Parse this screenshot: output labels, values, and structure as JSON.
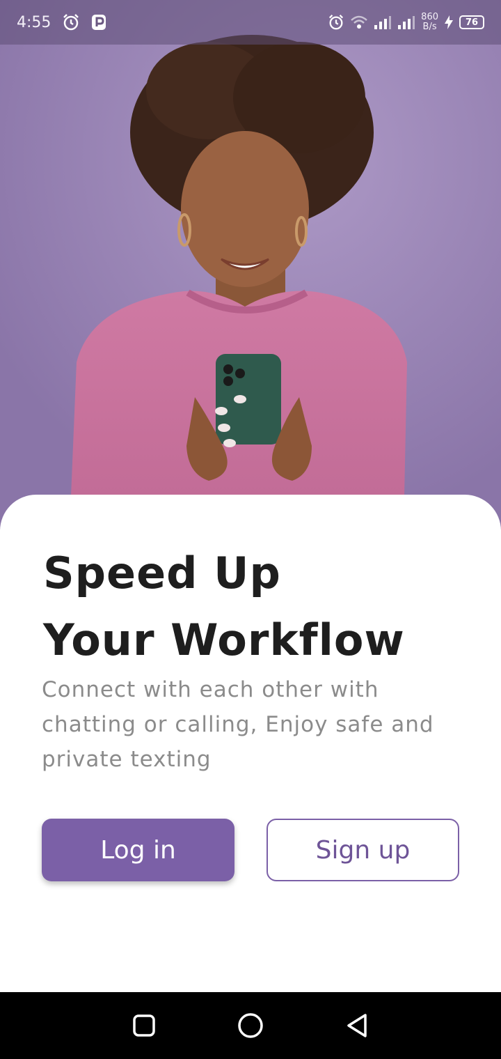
{
  "status_bar": {
    "time": "4:55",
    "net_speed_value": "860",
    "net_speed_unit": "B/s",
    "battery": "76"
  },
  "hero": {
    "image": "woman-in-pink-sweater-smiling-at-phone",
    "background_color": "#9a86b8"
  },
  "content": {
    "headline_line1": "Speed Up",
    "headline_line2": "Your Workflow",
    "subtitle": "Connect with each other with chatting or calling, Enjoy safe and private texting"
  },
  "actions": {
    "login_label": "Log in",
    "signup_label": "Sign up",
    "accent_color": "#7b60a7"
  },
  "nav": {
    "recents": "square-icon",
    "home": "circle-icon",
    "back": "triangle-back-icon"
  }
}
